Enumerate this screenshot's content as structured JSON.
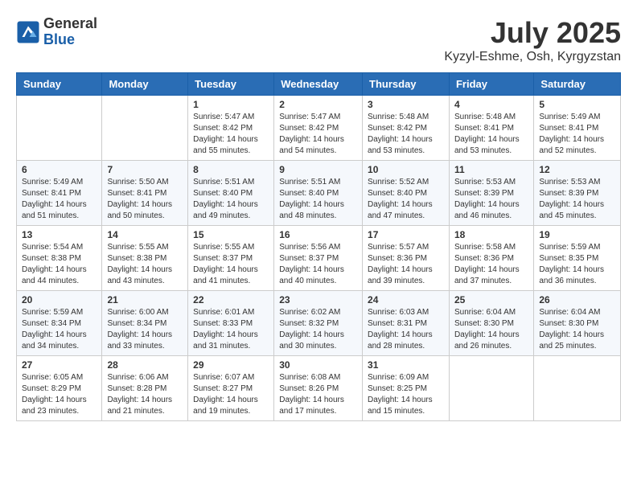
{
  "logo": {
    "general": "General",
    "blue": "Blue"
  },
  "title": "July 2025",
  "subtitle": "Kyzyl-Eshme, Osh, Kyrgyzstan",
  "days_of_week": [
    "Sunday",
    "Monday",
    "Tuesday",
    "Wednesday",
    "Thursday",
    "Friday",
    "Saturday"
  ],
  "weeks": [
    [
      {
        "day": "",
        "info": ""
      },
      {
        "day": "",
        "info": ""
      },
      {
        "day": "1",
        "info": "Sunrise: 5:47 AM\nSunset: 8:42 PM\nDaylight: 14 hours and 55 minutes."
      },
      {
        "day": "2",
        "info": "Sunrise: 5:47 AM\nSunset: 8:42 PM\nDaylight: 14 hours and 54 minutes."
      },
      {
        "day": "3",
        "info": "Sunrise: 5:48 AM\nSunset: 8:42 PM\nDaylight: 14 hours and 53 minutes."
      },
      {
        "day": "4",
        "info": "Sunrise: 5:48 AM\nSunset: 8:41 PM\nDaylight: 14 hours and 53 minutes."
      },
      {
        "day": "5",
        "info": "Sunrise: 5:49 AM\nSunset: 8:41 PM\nDaylight: 14 hours and 52 minutes."
      }
    ],
    [
      {
        "day": "6",
        "info": "Sunrise: 5:49 AM\nSunset: 8:41 PM\nDaylight: 14 hours and 51 minutes."
      },
      {
        "day": "7",
        "info": "Sunrise: 5:50 AM\nSunset: 8:41 PM\nDaylight: 14 hours and 50 minutes."
      },
      {
        "day": "8",
        "info": "Sunrise: 5:51 AM\nSunset: 8:40 PM\nDaylight: 14 hours and 49 minutes."
      },
      {
        "day": "9",
        "info": "Sunrise: 5:51 AM\nSunset: 8:40 PM\nDaylight: 14 hours and 48 minutes."
      },
      {
        "day": "10",
        "info": "Sunrise: 5:52 AM\nSunset: 8:40 PM\nDaylight: 14 hours and 47 minutes."
      },
      {
        "day": "11",
        "info": "Sunrise: 5:53 AM\nSunset: 8:39 PM\nDaylight: 14 hours and 46 minutes."
      },
      {
        "day": "12",
        "info": "Sunrise: 5:53 AM\nSunset: 8:39 PM\nDaylight: 14 hours and 45 minutes."
      }
    ],
    [
      {
        "day": "13",
        "info": "Sunrise: 5:54 AM\nSunset: 8:38 PM\nDaylight: 14 hours and 44 minutes."
      },
      {
        "day": "14",
        "info": "Sunrise: 5:55 AM\nSunset: 8:38 PM\nDaylight: 14 hours and 43 minutes."
      },
      {
        "day": "15",
        "info": "Sunrise: 5:55 AM\nSunset: 8:37 PM\nDaylight: 14 hours and 41 minutes."
      },
      {
        "day": "16",
        "info": "Sunrise: 5:56 AM\nSunset: 8:37 PM\nDaylight: 14 hours and 40 minutes."
      },
      {
        "day": "17",
        "info": "Sunrise: 5:57 AM\nSunset: 8:36 PM\nDaylight: 14 hours and 39 minutes."
      },
      {
        "day": "18",
        "info": "Sunrise: 5:58 AM\nSunset: 8:36 PM\nDaylight: 14 hours and 37 minutes."
      },
      {
        "day": "19",
        "info": "Sunrise: 5:59 AM\nSunset: 8:35 PM\nDaylight: 14 hours and 36 minutes."
      }
    ],
    [
      {
        "day": "20",
        "info": "Sunrise: 5:59 AM\nSunset: 8:34 PM\nDaylight: 14 hours and 34 minutes."
      },
      {
        "day": "21",
        "info": "Sunrise: 6:00 AM\nSunset: 8:34 PM\nDaylight: 14 hours and 33 minutes."
      },
      {
        "day": "22",
        "info": "Sunrise: 6:01 AM\nSunset: 8:33 PM\nDaylight: 14 hours and 31 minutes."
      },
      {
        "day": "23",
        "info": "Sunrise: 6:02 AM\nSunset: 8:32 PM\nDaylight: 14 hours and 30 minutes."
      },
      {
        "day": "24",
        "info": "Sunrise: 6:03 AM\nSunset: 8:31 PM\nDaylight: 14 hours and 28 minutes."
      },
      {
        "day": "25",
        "info": "Sunrise: 6:04 AM\nSunset: 8:30 PM\nDaylight: 14 hours and 26 minutes."
      },
      {
        "day": "26",
        "info": "Sunrise: 6:04 AM\nSunset: 8:30 PM\nDaylight: 14 hours and 25 minutes."
      }
    ],
    [
      {
        "day": "27",
        "info": "Sunrise: 6:05 AM\nSunset: 8:29 PM\nDaylight: 14 hours and 23 minutes."
      },
      {
        "day": "28",
        "info": "Sunrise: 6:06 AM\nSunset: 8:28 PM\nDaylight: 14 hours and 21 minutes."
      },
      {
        "day": "29",
        "info": "Sunrise: 6:07 AM\nSunset: 8:27 PM\nDaylight: 14 hours and 19 minutes."
      },
      {
        "day": "30",
        "info": "Sunrise: 6:08 AM\nSunset: 8:26 PM\nDaylight: 14 hours and 17 minutes."
      },
      {
        "day": "31",
        "info": "Sunrise: 6:09 AM\nSunset: 8:25 PM\nDaylight: 14 hours and 15 minutes."
      },
      {
        "day": "",
        "info": ""
      },
      {
        "day": "",
        "info": ""
      }
    ]
  ]
}
